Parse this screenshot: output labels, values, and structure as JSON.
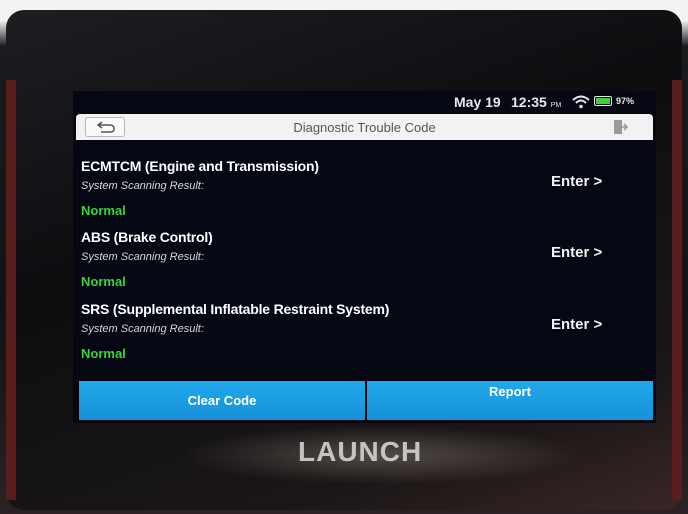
{
  "status_bar": {
    "date": "May 19",
    "time": "12:35",
    "ampm": "PM",
    "battery": "97%",
    "battery_level": 0.97
  },
  "header": {
    "title": "Diagnostic Trouble Code",
    "back_icon": "back-arrow-icon",
    "exit_icon": "exit-icon"
  },
  "systems": [
    {
      "name": "ECMTCM (Engine and Transmission)",
      "result_label": "System Scanning Result:",
      "result": "Normal",
      "action": "Enter >"
    },
    {
      "name": "ABS (Brake Control)",
      "result_label": "System Scanning Result:",
      "result": "Normal",
      "action": "Enter >"
    },
    {
      "name": "SRS (Supplemental Inflatable Restraint System)",
      "result_label": "System Scanning Result:",
      "result": "Normal",
      "action": "Enter >"
    }
  ],
  "buttons": {
    "clear_code": "Clear Code",
    "report": "Report"
  },
  "device": {
    "brand": "LAUNCH"
  },
  "colors": {
    "accent": "#1a9be0",
    "normal_status": "#38d43a",
    "screen_bg": "#050713"
  }
}
